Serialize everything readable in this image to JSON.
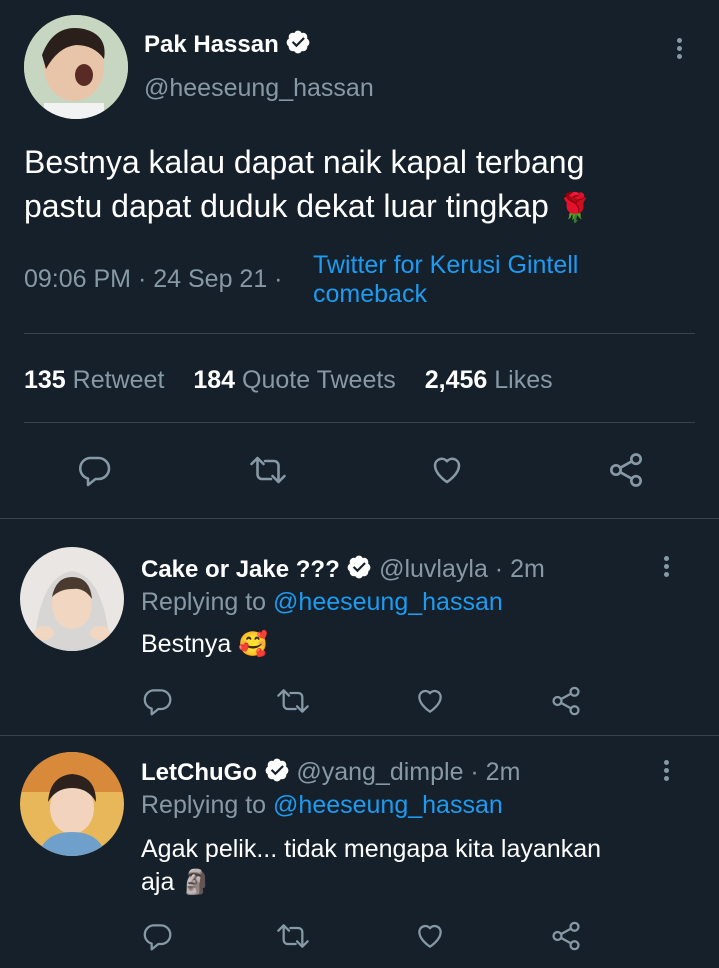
{
  "main_tweet": {
    "author_name": "Pak Hassan",
    "handle": "@heeseung_hassan",
    "text_line1": "Bestnya kalau dapat naik kapal terbang",
    "text_line2": "pastu dapat duduk dekat luar tingkap",
    "emoji": "🌹",
    "time": "09:06 PM",
    "date": "· 24 Sep 21 ·",
    "source_line1": "Twitter for Kerusi Gintell",
    "source_line2": "comeback",
    "stats": {
      "retweets_count": "135",
      "retweets_label": "Retweet",
      "quotes_count": "184",
      "quotes_label": "Quote Tweets",
      "likes_count": "2,456",
      "likes_label": "Likes"
    }
  },
  "replies": [
    {
      "author_name": "Cake or Jake ???",
      "handle_time": "@luvlayla · 2m",
      "replying_label": "Replying to",
      "replying_handle": "@heeseung_hassan",
      "text_line1": "Bestnya",
      "emoji": "🥰"
    },
    {
      "author_name": "LetChuGo",
      "handle_time": "@yang_dimple · 2m",
      "replying_label": "Replying to",
      "replying_handle": "@heeseung_hassan",
      "text_line1": "Agak pelik... tidak mengapa kita layankan",
      "text_line2": "aja",
      "emoji": "🗿"
    }
  ],
  "icons": [
    "reply-icon",
    "retweet-icon",
    "like-icon",
    "share-icon",
    "verified-icon",
    "more-icon"
  ],
  "colors": {
    "background": "#15202b",
    "accent": "#1d9bf0",
    "muted": "#8899a6",
    "divider": "#38444d"
  }
}
